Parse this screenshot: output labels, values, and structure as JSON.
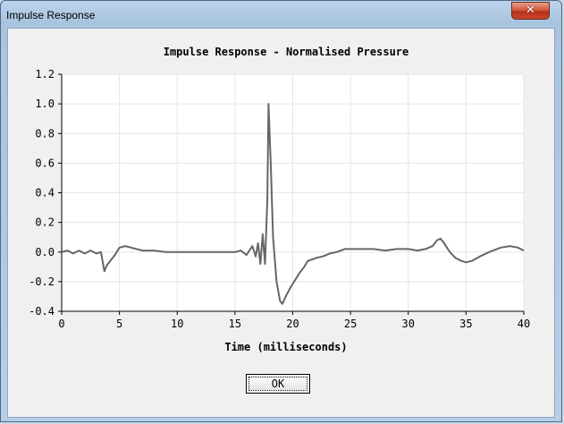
{
  "window": {
    "title": "Impulse Response",
    "close_glyph": "✕"
  },
  "ok_button": {
    "label": "OK"
  },
  "chart_data": {
    "type": "line",
    "title": "Impulse Response - Normalised Pressure",
    "xlabel": "Time (milliseconds)",
    "ylabel": "",
    "xlim": [
      0,
      40
    ],
    "ylim": [
      -0.4,
      1.2
    ],
    "xticks": [
      0,
      5,
      10,
      15,
      20,
      25,
      30,
      35,
      40
    ],
    "yticks": [
      1.2,
      1.0,
      0.8,
      0.6,
      0.4,
      0.2,
      0.0,
      -0.2,
      -0.4
    ],
    "xtick_labels": [
      "0",
      "5",
      "10",
      "15",
      "20",
      "25",
      "30",
      "35",
      "40"
    ],
    "ytick_labels": [
      "1.2",
      "1.0",
      "0.8",
      "0.6",
      "0.4",
      "0.2",
      "0.0",
      "-0.2",
      "-0.4"
    ],
    "grid": true,
    "line_color": "#666666",
    "series": [
      {
        "x": [
          0,
          0.5,
          1,
          1.5,
          2,
          2.5,
          3,
          3.4,
          3.7,
          3.9,
          4.2,
          4.6,
          5.0,
          5.5,
          6.0,
          7,
          8,
          9,
          10,
          11,
          12,
          13,
          14,
          15,
          15.5,
          16,
          16.5,
          16.8,
          17.0,
          17.2,
          17.4,
          17.6,
          17.8,
          17.9,
          18.1,
          18.3,
          18.6,
          18.9,
          19.1,
          19.4,
          19.8,
          20.2,
          20.6,
          21.0,
          21.3,
          21.7,
          22.0,
          22.6,
          23.2,
          23.8,
          24.5,
          25.2,
          26,
          27,
          28,
          29,
          30,
          30.8,
          31.5,
          32.1,
          32.5,
          32.8,
          33.1,
          33.6,
          34.1,
          34.6,
          35.0,
          35.5,
          36.2,
          37,
          38,
          38.8,
          39.5,
          40
        ],
        "y": [
          0.0,
          0.01,
          -0.01,
          0.01,
          -0.01,
          0.01,
          -0.01,
          0.0,
          -0.13,
          -0.09,
          -0.06,
          -0.02,
          0.03,
          0.04,
          0.03,
          0.01,
          0.01,
          0.0,
          0.0,
          0.0,
          0.0,
          0.0,
          0.0,
          0.0,
          0.01,
          -0.02,
          0.04,
          -0.03,
          0.06,
          -0.08,
          0.12,
          -0.08,
          0.35,
          1.0,
          0.6,
          0.1,
          -0.2,
          -0.33,
          -0.35,
          -0.3,
          -0.24,
          -0.19,
          -0.14,
          -0.1,
          -0.06,
          -0.05,
          -0.04,
          -0.03,
          -0.01,
          0.0,
          0.02,
          0.02,
          0.02,
          0.02,
          0.01,
          0.02,
          0.02,
          0.01,
          0.02,
          0.04,
          0.08,
          0.09,
          0.06,
          0.0,
          -0.04,
          -0.06,
          -0.07,
          -0.06,
          -0.03,
          0.0,
          0.03,
          0.04,
          0.03,
          0.01
        ]
      }
    ]
  }
}
